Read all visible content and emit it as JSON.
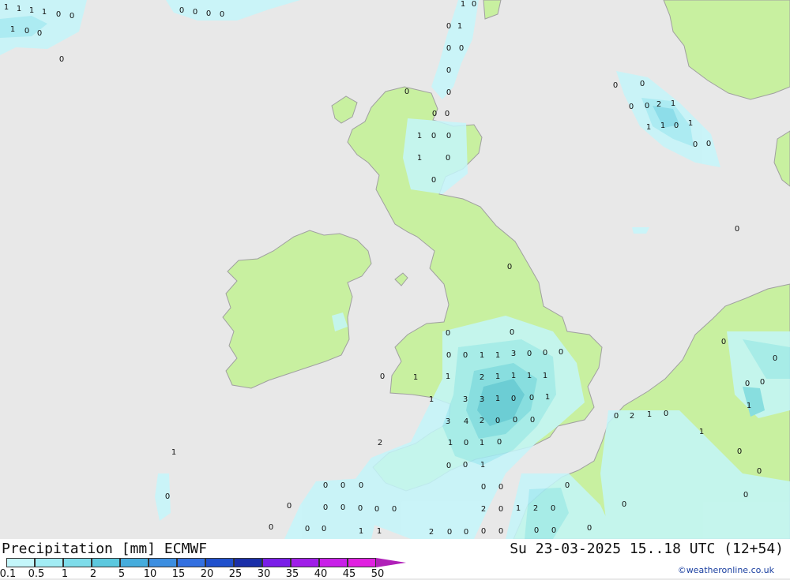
{
  "header": {
    "title": "Precipitation [mm] ECMWF",
    "valid_time": "Su 23-03-2025 15..18 UTC (12+54)",
    "credit": "©weatheronline.co.uk"
  },
  "colors": {
    "sea": "#e8e8e8",
    "land": "#c8f0a0",
    "coast": "#a0a0a0"
  },
  "legend": {
    "ticks": [
      "0.1",
      "0.5",
      "1",
      "2",
      "5",
      "10",
      "15",
      "20",
      "25",
      "30",
      "35",
      "40",
      "45",
      "50"
    ],
    "colors": [
      "#c4f6fa",
      "#a2ecf4",
      "#7edcea",
      "#5cc8de",
      "#46acdc",
      "#3c8ee0",
      "#3370e0",
      "#2050cc",
      "#1a2fa8",
      "#7a1ee8",
      "#a01ee8",
      "#c820e8",
      "#e020e0",
      "#b020b8"
    ]
  },
  "values": [
    {
      "t": "1"
    },
    {
      "t": "1"
    },
    {
      "t": "1"
    },
    {
      "t": "1"
    },
    {
      "t": "0"
    },
    {
      "t": "0"
    },
    {
      "t": "1"
    },
    {
      "t": "0"
    },
    {
      "t": "0"
    },
    {
      "t": "0"
    },
    {
      "t": "0"
    },
    {
      "t": "0"
    },
    {
      "t": "0"
    },
    {
      "t": "0"
    },
    {
      "t": "1"
    },
    {
      "t": "0"
    },
    {
      "t": "0"
    },
    {
      "t": "1"
    },
    {
      "t": "0"
    },
    {
      "t": "0"
    },
    {
      "t": "0"
    },
    {
      "t": "0"
    },
    {
      "t": "0"
    },
    {
      "t": "0"
    },
    {
      "t": "0"
    },
    {
      "t": "1"
    },
    {
      "t": "0"
    },
    {
      "t": "0"
    },
    {
      "t": "1"
    },
    {
      "t": "0"
    },
    {
      "t": "0"
    },
    {
      "t": "0"
    },
    {
      "t": "0"
    },
    {
      "t": "2"
    },
    {
      "t": "1"
    },
    {
      "t": "0"
    },
    {
      "t": "0"
    },
    {
      "t": "1"
    },
    {
      "t": "1"
    },
    {
      "t": "0"
    },
    {
      "t": "1"
    },
    {
      "t": "0"
    },
    {
      "t": "0"
    },
    {
      "t": "0"
    },
    {
      "t": "0"
    },
    {
      "t": "0"
    },
    {
      "t": "0"
    },
    {
      "t": "0"
    },
    {
      "t": "0"
    },
    {
      "t": "1"
    },
    {
      "t": "1"
    },
    {
      "t": "3"
    },
    {
      "t": "0"
    },
    {
      "t": "0"
    },
    {
      "t": "0"
    },
    {
      "t": "0"
    },
    {
      "t": "1"
    },
    {
      "t": "1"
    },
    {
      "t": "2"
    },
    {
      "t": "1"
    },
    {
      "t": "1"
    },
    {
      "t": "1"
    },
    {
      "t": "1"
    },
    {
      "t": "1"
    },
    {
      "t": "3"
    },
    {
      "t": "3"
    },
    {
      "t": "1"
    },
    {
      "t": "0"
    },
    {
      "t": "0"
    },
    {
      "t": "1"
    },
    {
      "t": "3"
    },
    {
      "t": "4"
    },
    {
      "t": "2"
    },
    {
      "t": "0"
    },
    {
      "t": "0"
    },
    {
      "t": "0"
    },
    {
      "t": "1"
    },
    {
      "t": "2"
    },
    {
      "t": "1"
    },
    {
      "t": "0"
    },
    {
      "t": "1"
    },
    {
      "t": "0"
    },
    {
      "t": "0"
    },
    {
      "t": "0"
    },
    {
      "t": "1"
    },
    {
      "t": "0"
    },
    {
      "t": "0"
    },
    {
      "t": "2"
    },
    {
      "t": "0"
    },
    {
      "t": "1"
    },
    {
      "t": "2"
    },
    {
      "t": "0"
    },
    {
      "t": "0"
    },
    {
      "t": "0"
    },
    {
      "t": "0"
    },
    {
      "t": "0"
    },
    {
      "t": "0"
    },
    {
      "t": "0"
    },
    {
      "t": "0"
    },
    {
      "t": "0"
    },
    {
      "t": "0"
    },
    {
      "t": "0"
    },
    {
      "t": "0"
    },
    {
      "t": "0"
    },
    {
      "t": "1"
    },
    {
      "t": "1"
    },
    {
      "t": "2"
    },
    {
      "t": "0"
    },
    {
      "t": "0"
    },
    {
      "t": "0"
    },
    {
      "t": "0"
    },
    {
      "t": "0"
    },
    {
      "t": "0"
    },
    {
      "t": "0"
    },
    {
      "t": "0"
    },
    {
      "t": "0"
    },
    {
      "t": "0"
    },
    {
      "t": "0"
    },
    {
      "t": "2"
    },
    {
      "t": "1"
    },
    {
      "t": "0"
    },
    {
      "t": "1"
    },
    {
      "t": "0"
    },
    {
      "t": "0"
    },
    {
      "t": "0"
    },
    {
      "t": "0"
    },
    {
      "t": "0"
    },
    {
      "t": "0"
    },
    {
      "t": "1"
    },
    {
      "t": "0"
    }
  ]
}
